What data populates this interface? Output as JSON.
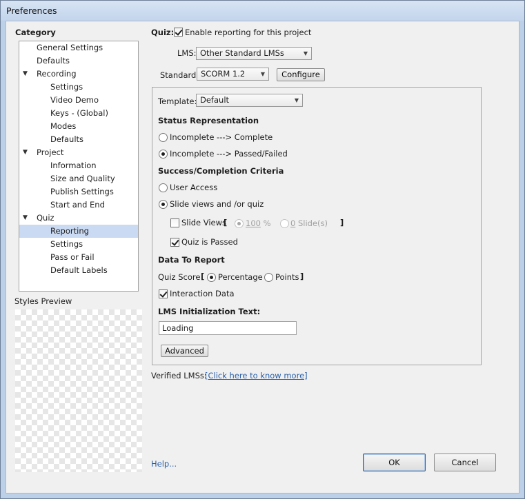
{
  "window": {
    "title": "Preferences"
  },
  "category": {
    "heading": "Category",
    "items": [
      {
        "label": "General Settings",
        "level": 0,
        "expander": ""
      },
      {
        "label": "Defaults",
        "level": 0,
        "expander": ""
      },
      {
        "label": "Recording",
        "level": 0,
        "expander": "▼"
      },
      {
        "label": "Settings",
        "level": 1,
        "expander": ""
      },
      {
        "label": "Video Demo",
        "level": 1,
        "expander": ""
      },
      {
        "label": "Keys - (Global)",
        "level": 1,
        "expander": ""
      },
      {
        "label": "Modes",
        "level": 1,
        "expander": ""
      },
      {
        "label": "Defaults",
        "level": 1,
        "expander": ""
      },
      {
        "label": "Project",
        "level": 0,
        "expander": "▼"
      },
      {
        "label": "Information",
        "level": 1,
        "expander": ""
      },
      {
        "label": "Size and Quality",
        "level": 1,
        "expander": ""
      },
      {
        "label": "Publish Settings",
        "level": 1,
        "expander": ""
      },
      {
        "label": "Start and End",
        "level": 1,
        "expander": ""
      },
      {
        "label": "Quiz",
        "level": 0,
        "expander": "▼"
      },
      {
        "label": "Reporting",
        "level": 1,
        "expander": "",
        "selected": true
      },
      {
        "label": "Settings",
        "level": 1,
        "expander": ""
      },
      {
        "label": "Pass or Fail",
        "level": 1,
        "expander": ""
      },
      {
        "label": "Default Labels",
        "level": 1,
        "expander": ""
      }
    ]
  },
  "styles_preview": {
    "label": "Styles Preview"
  },
  "quiz": {
    "label": "Quiz:",
    "enable_label": "Enable reporting for this project",
    "enable_checked": true
  },
  "lms": {
    "label": "LMS:",
    "value": "Other Standard LMSs"
  },
  "standard": {
    "label": "Standard:",
    "value": "SCORM 1.2",
    "configure_label": "Configure"
  },
  "template": {
    "label": "Template:",
    "value": "Default"
  },
  "status": {
    "heading": "Status Representation",
    "options": [
      {
        "label": "Incomplete ---> Complete",
        "checked": false
      },
      {
        "label": "Incomplete ---> Passed/Failed",
        "checked": true
      }
    ]
  },
  "criteria": {
    "heading": "Success/Completion Criteria",
    "user_access_label": "User Access",
    "user_access_checked": false,
    "slide_views_quiz_label": "Slide views and /or quiz",
    "slide_views_quiz_checked": true,
    "slide_views_label": "Slide Views",
    "slide_views_checked": false,
    "bracket_open": "[",
    "bracket_close": "]",
    "percent_value": "100",
    "percent_unit": "%",
    "slides_value": "0",
    "slides_unit": "Slide(s)",
    "quiz_passed_label": "Quiz is Passed",
    "quiz_passed_checked": true
  },
  "data_to_report": {
    "heading": "Data To Report",
    "quiz_score_label": "Quiz Score",
    "bracket_open": "[",
    "bracket_close": "]",
    "percentage_label": "Percentage",
    "percentage_checked": true,
    "points_label": "Points",
    "points_checked": false,
    "interaction_label": "Interaction Data",
    "interaction_checked": true
  },
  "lms_init": {
    "heading": "LMS Initialization Text:",
    "value": "Loading"
  },
  "advanced_label": "Advanced",
  "verified": {
    "label": "Verified LMSs:",
    "link": "[Click here to know more]"
  },
  "help_label": "Help...",
  "ok_label": "OK",
  "cancel_label": "Cancel"
}
